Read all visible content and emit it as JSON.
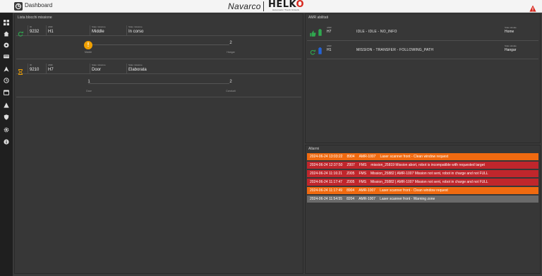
{
  "header": {
    "title": "Dashboard",
    "brand": "Navarco",
    "logo_text": "HELK",
    "logo_accent": "O",
    "logo_sub": "Automatic Truck Unlock"
  },
  "colors": {
    "accent_orange": "#f06a10",
    "alarm_red": "#c0262c",
    "alarm_gray": "#6a6a6a",
    "ok_green": "#2fa84f",
    "battery_blue": "#2463d6",
    "warning_amber": "#f0a000"
  },
  "sidebar": {
    "icons": [
      "grid-icon",
      "home-icon",
      "settings-cog-icon",
      "truck-icon",
      "route-icon",
      "history-icon",
      "calendar-icon",
      "warning-icon",
      "shield-icon",
      "gear-icon",
      "info-icon"
    ]
  },
  "blocks_panel": {
    "title": "Lista blocchi missione",
    "blocks": [
      {
        "icon": "refresh-icon",
        "fields": [
          {
            "label": "ID",
            "value": "9232"
          },
          {
            "label": "AMR",
            "value": "H1"
          },
          {
            "label": "Stato missione",
            "value": "Middle"
          },
          {
            "label": "Stato missione",
            "value": "In corso"
          }
        ],
        "steps": [
          {
            "num": "",
            "label": "Middle",
            "warning": "!"
          },
          {
            "num": "2",
            "label": "Hangar"
          }
        ]
      },
      {
        "icon": "hourglass-icon",
        "fields": [
          {
            "label": "ID",
            "value": "9210"
          },
          {
            "label": "AMR",
            "value": "H7"
          },
          {
            "label": "Stato missione",
            "value": "Door"
          },
          {
            "label": "Stato missione",
            "value": "Elaborata"
          }
        ],
        "steps": [
          {
            "num": "1",
            "label": "Door"
          },
          {
            "num": "2",
            "label": "Conducti"
          }
        ]
      }
    ]
  },
  "amr_panel": {
    "title": "AMR abilitati",
    "rows": [
      {
        "status_icon": "thumbs-up-icon",
        "battery_icon": "battery-icon",
        "battery_color": "#2fa84f",
        "name_label": "AMR",
        "name": "H7",
        "state": "IDLE - IDLE - NO_INFO",
        "position_label": "Stato attuale",
        "position": "Home"
      },
      {
        "status_icon": "refresh-icon",
        "battery_icon": "battery-icon",
        "battery_color": "#2463d6",
        "name_label": "AMR",
        "name": "H1",
        "state": "MISSION - TRANSFER - FOLLOWING_PATH",
        "position_label": "Stato attuale",
        "position": "Hangar"
      }
    ]
  },
  "alarm_panel": {
    "title": "Allarmi",
    "alarms": [
      {
        "color": "#f06a10",
        "time": "2024-06-24 13:03:22",
        "code": "8904",
        "source": "AMR-1007",
        "message": "Laser scanner front - Clean window request"
      },
      {
        "color": "#c0262c",
        "time": "2024-06-24 12:37:50",
        "code": "Z007",
        "source": "FMS",
        "message": "mission_25819 Mission abort, robot is incompatible with requested target"
      },
      {
        "color": "#c0262c",
        "time": "2024-06-24 11:16:21",
        "code": "Z005",
        "source": "FMS",
        "message": "Mission_25882 | AMR-1007 Mission not sent, robot in charge and not FULL"
      },
      {
        "color": "#c0262c",
        "time": "2024-06-24 11:17:47",
        "code": "Z005",
        "source": "FMS",
        "message": "Mission_25882 | AMR-1007 Mission not sent, robot in charge and not FULL"
      },
      {
        "color": "#f06a10",
        "time": "2024-06-24 11:17:49",
        "code": "8904",
        "source": "AMR-1007",
        "message": "Laser scanner front - Clean window request"
      },
      {
        "color": "#6a6a6a",
        "time": "2024-06-24 11:54:55",
        "code": "8204",
        "source": "AMR-1007",
        "message": "Laser scanner front - Warning zone"
      }
    ]
  }
}
